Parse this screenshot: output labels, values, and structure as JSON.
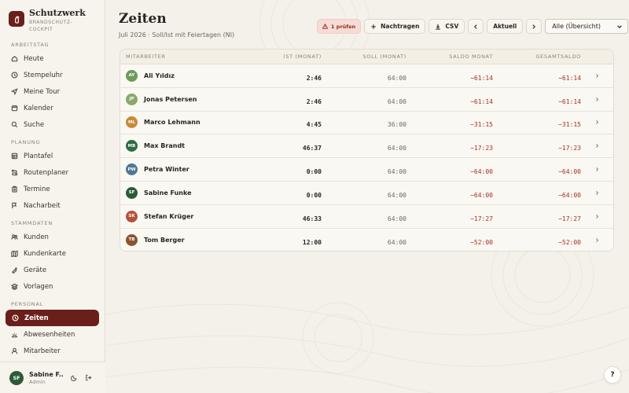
{
  "brand": {
    "title": "Schutzwerk",
    "subtitle": "BRANDSCHUTZ-COCKPIT"
  },
  "sidebar": {
    "sections": [
      {
        "label": "ARBEITSTAG",
        "items": [
          {
            "label": "Heute",
            "icon": "home-icon"
          },
          {
            "label": "Stempeluhr",
            "icon": "clock-icon"
          },
          {
            "label": "Meine Tour",
            "icon": "navigation-icon"
          },
          {
            "label": "Kalender",
            "icon": "calendar-icon"
          },
          {
            "label": "Suche",
            "icon": "search-icon"
          }
        ]
      },
      {
        "label": "PLANUNG",
        "items": [
          {
            "label": "Plantafel",
            "icon": "grid-icon"
          },
          {
            "label": "Routenplaner",
            "icon": "route-icon"
          },
          {
            "label": "Termine",
            "icon": "clipboard-icon"
          },
          {
            "label": "Nacharbeit",
            "icon": "flag-icon"
          }
        ]
      },
      {
        "label": "STAMMDATEN",
        "items": [
          {
            "label": "Kunden",
            "icon": "users-icon"
          },
          {
            "label": "Kundenkarte",
            "icon": "map-icon"
          },
          {
            "label": "Geräte",
            "icon": "extinguisher-icon"
          },
          {
            "label": "Vorlagen",
            "icon": "layers-icon"
          }
        ]
      },
      {
        "label": "PERSONAL",
        "items": [
          {
            "label": "Zeiten",
            "icon": "clock-icon",
            "active": true
          },
          {
            "label": "Abwesenheiten",
            "icon": "sun-icon"
          },
          {
            "label": "Mitarbeiter",
            "icon": "user-icon"
          }
        ]
      }
    ]
  },
  "user": {
    "initials": "SF",
    "name": "Sabine F...",
    "role": "Admin"
  },
  "page": {
    "title": "Zeiten",
    "subtitle": "Juli 2026 · Soll/Ist mit Feiertagen (NI)"
  },
  "toolbar": {
    "warn_label": "1 prüfen",
    "nachtragen_label": "Nachtragen",
    "csv_label": "CSV",
    "aktuell_label": "Aktuell",
    "filter_value": "Alle (Übersicht)"
  },
  "table": {
    "headers": {
      "name": "MITARBEITER",
      "ist": "IST (MONAT)",
      "soll": "SOLL (MONAT)",
      "saldo": "SALDO MONAT",
      "gesamt": "GESAMTSALDO"
    },
    "rows": [
      {
        "initials": "AY",
        "color": "#6f9a5a",
        "name": "Ali Yıldız",
        "ist": "2:46",
        "soll": "64:00",
        "saldo": "−61:14",
        "gesamt": "−61:14"
      },
      {
        "initials": "JP",
        "color": "#8aa86e",
        "name": "Jonas Petersen",
        "ist": "2:46",
        "soll": "64:00",
        "saldo": "−61:14",
        "gesamt": "−61:14"
      },
      {
        "initials": "ML",
        "color": "#c98a36",
        "name": "Marco Lehmann",
        "ist": "4:45",
        "soll": "36:00",
        "saldo": "−31:15",
        "gesamt": "−31:15"
      },
      {
        "initials": "MB",
        "color": "#2f6b45",
        "name": "Max Brandt",
        "ist": "46:37",
        "soll": "64:00",
        "saldo": "−17:23",
        "gesamt": "−17:23"
      },
      {
        "initials": "PW",
        "color": "#4f7898",
        "name": "Petra Winter",
        "ist": "0:00",
        "soll": "64:00",
        "saldo": "−64:00",
        "gesamt": "−64:00"
      },
      {
        "initials": "SF",
        "color": "#2c5a3a",
        "name": "Sabine Funke",
        "ist": "0:00",
        "soll": "64:00",
        "saldo": "−64:00",
        "gesamt": "−64:00"
      },
      {
        "initials": "SK",
        "color": "#b8503a",
        "name": "Stefan Krüger",
        "ist": "46:33",
        "soll": "64:00",
        "saldo": "−17:27",
        "gesamt": "−17:27"
      },
      {
        "initials": "TB",
        "color": "#8a5530",
        "name": "Tom Berger",
        "ist": "12:00",
        "soll": "64:00",
        "saldo": "−52:00",
        "gesamt": "−52:00"
      }
    ]
  },
  "help": {
    "label": "?"
  },
  "colors": {
    "accent": "#6b1f1a",
    "negative": "#a33125",
    "background": "#f4f1ea"
  }
}
